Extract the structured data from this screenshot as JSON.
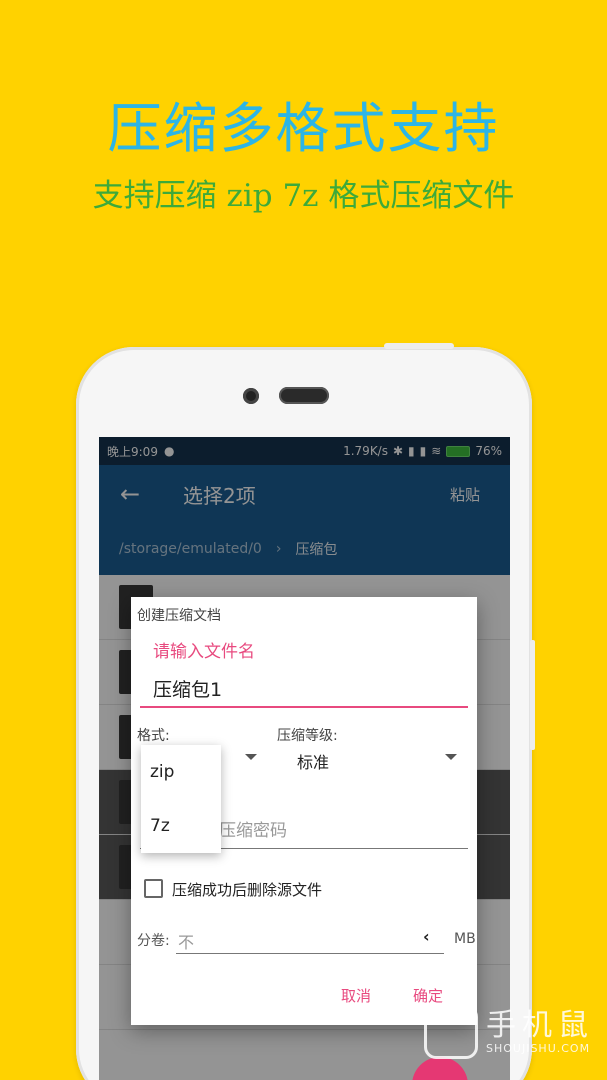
{
  "promo": {
    "headline": "压缩多格式支持",
    "subline": "支持压缩 zip 7z 格式压缩文件"
  },
  "statusbar": {
    "time": "晚上9:09",
    "speed": "1.79K/s",
    "battery": "76%",
    "icons": [
      "cat-icon",
      "bluetooth-icon",
      "signal-icon",
      "signal-icon",
      "wifi-icon",
      "battery-icon"
    ]
  },
  "appbar": {
    "title": "选择2项",
    "paste_label": "粘贴"
  },
  "pathbar": {
    "path": "/storage/emulated/0",
    "separator": "›",
    "current": "压缩包"
  },
  "dialog": {
    "title": "创建压缩文档",
    "filename_label": "请输入文件名",
    "filename_value": "压缩包1",
    "format_label": "格式:",
    "level_label": "压缩等级:",
    "level_value": "标准",
    "password_placeholder": "压缩密码",
    "delete_source_label": "压缩成功后删除源文件",
    "delete_source_checked": false,
    "split_label": "分卷:",
    "split_value": "不",
    "split_unit": "MB",
    "cancel_label": "取消",
    "ok_label": "确定"
  },
  "format_dropdown": {
    "options": [
      "zip",
      "7z"
    ]
  },
  "colors": {
    "background": "#FFD200",
    "headline": "#2CB5E6",
    "subline": "#3DAA3A",
    "appbar": "#1A5E93",
    "accent": "#E84A7F"
  }
}
